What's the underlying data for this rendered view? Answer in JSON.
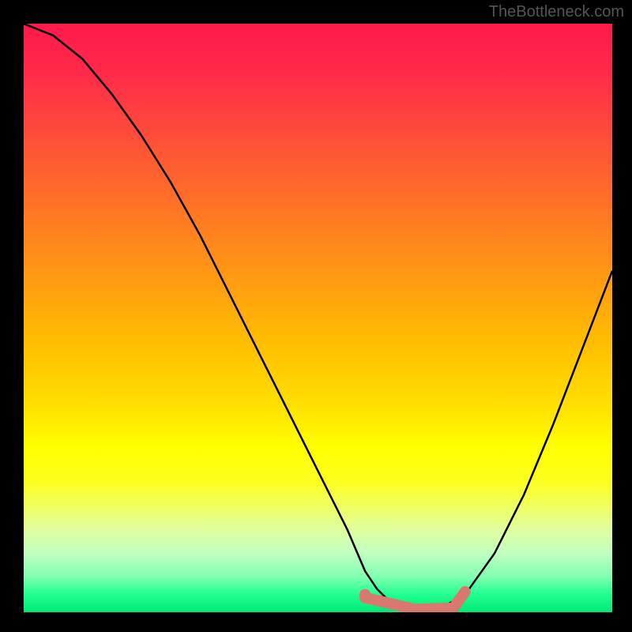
{
  "watermark": "TheBottleneck.com",
  "chart_data": {
    "type": "line",
    "title": "",
    "xlabel": "",
    "ylabel": "",
    "x_range": [
      0,
      100
    ],
    "y_range": [
      0,
      100
    ],
    "gradient_direction": "top-to-bottom",
    "gradient_meaning": "bottleneck severity (red=high, green=low)",
    "series": [
      {
        "name": "bottleneck-curve",
        "color": "#000000",
        "x": [
          0,
          5,
          10,
          15,
          20,
          25,
          30,
          35,
          40,
          45,
          50,
          55,
          58,
          60,
          62,
          65,
          70,
          75,
          80,
          85,
          90,
          95,
          100
        ],
        "y": [
          100,
          98,
          94,
          88,
          81,
          73,
          64,
          54,
          44,
          34,
          24,
          14,
          7,
          4,
          2,
          0.5,
          0.2,
          3,
          10,
          20,
          32,
          45,
          58
        ]
      }
    ],
    "highlight": {
      "name": "optimal-zone",
      "color": "#d9786e",
      "x_start": 58,
      "x_end": 75,
      "y": 0.5,
      "dot": {
        "x": 58,
        "y": 3
      }
    }
  },
  "colors": {
    "curve": "#000000",
    "highlight": "#d9786e",
    "background_frame": "#000000"
  }
}
